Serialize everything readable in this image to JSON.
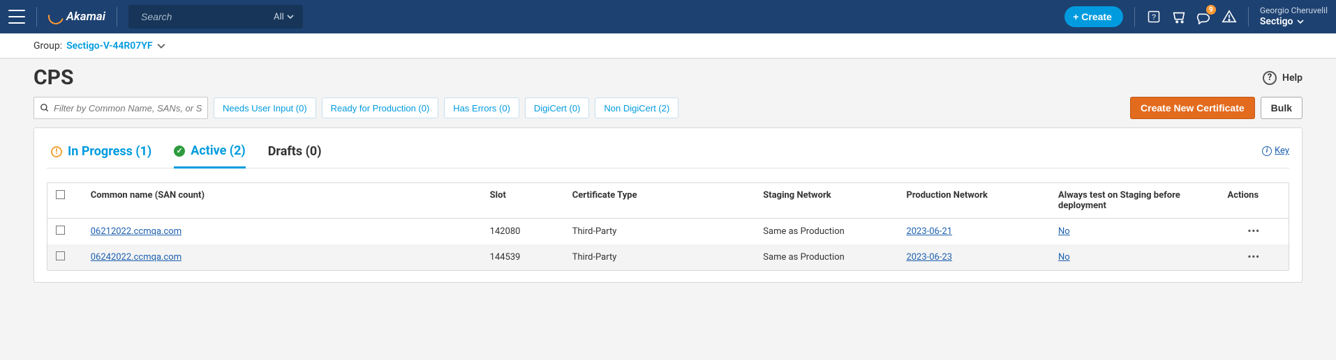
{
  "header": {
    "brand": "Akamai",
    "search_placeholder": "Search",
    "search_scope": "All",
    "create_label": "+  Create",
    "notification_count": "9",
    "user_name": "Georgio Cheruvelil",
    "user_org": "Sectigo"
  },
  "groupbar": {
    "label": "Group:",
    "group_name": "Sectigo-V-44R07YF"
  },
  "page": {
    "title": "CPS",
    "help_label": "Help",
    "filter_placeholder": "Filter by Common Name, SANs, or Slot",
    "pills": [
      "Needs User Input (0)",
      "Ready for Production (0)",
      "Has Errors (0)",
      "DigiCert (0)",
      "Non DigiCert (2)"
    ],
    "create_cert_label": "Create New Certificate",
    "bulk_label": "Bulk"
  },
  "tabs": {
    "in_progress": "In Progress (1)",
    "active": "Active (2)",
    "drafts": "Drafts (0)",
    "key": "Key"
  },
  "table": {
    "headers": {
      "common_name": "Common name (SAN count)",
      "slot": "Slot",
      "cert_type": "Certificate Type",
      "staging": "Staging Network",
      "production": "Production Network",
      "always_test": "Always test on Staging before deployment",
      "actions": "Actions"
    },
    "rows": [
      {
        "cn": "06212022.ccmqa.com",
        "slot": "142080",
        "ct": "Third-Party",
        "sn": "Same as Production",
        "pn": "2023-06-21",
        "at": "No"
      },
      {
        "cn": "06242022.ccmqa.com",
        "slot": "144539",
        "ct": "Third-Party",
        "sn": "Same as Production",
        "pn": "2023-06-23",
        "at": "No"
      }
    ]
  }
}
